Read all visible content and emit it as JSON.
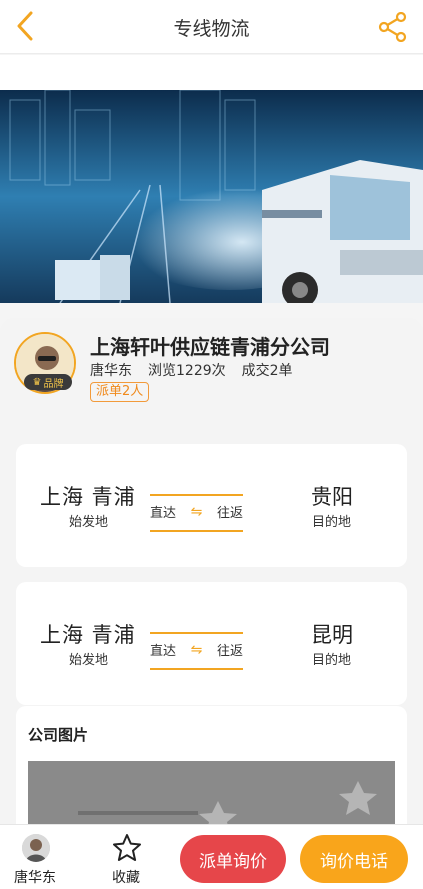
{
  "header": {
    "title": "专线物流",
    "back_icon": "chevron-left-icon",
    "share_icon": "share-icon",
    "accent": "#f2a521"
  },
  "company": {
    "name": "上海轩叶供应链青浦分公司",
    "contact": "唐华东",
    "views": "浏览1229次",
    "deals": "成交2单",
    "dispatch": "派单2人",
    "brand_badge": "品牌"
  },
  "routes": [
    {
      "origin": "上海 青浦",
      "origin_label": "始发地",
      "mode": "直达",
      "trip": "往返",
      "destination": "贵阳",
      "destination_label": "目的地"
    },
    {
      "origin": "上海 青浦",
      "origin_label": "始发地",
      "mode": "直达",
      "trip": "往返",
      "destination": "昆明",
      "destination_label": "目的地"
    }
  ],
  "photos": {
    "title": "公司图片"
  },
  "bottom_bar": {
    "contact_label": "唐华东",
    "favorite_label": "收藏",
    "favorite_icon": "star-icon",
    "dispatch_button": "派单询价",
    "phone_button": "询价电话",
    "dispatch_color": "#e6464a",
    "phone_color": "#f9a51b"
  }
}
